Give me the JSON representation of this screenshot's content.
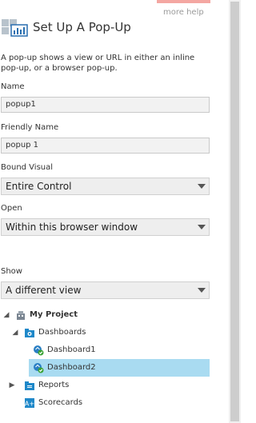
{
  "header": {
    "more_help": "more help",
    "title": "Set Up A Pop-Up",
    "description": "A pop-up shows a view or URL in either an inline pop-up, or a browser pop-up."
  },
  "fields": {
    "name_label": "Name",
    "name_value": "popup1",
    "friendly_label": "Friendly Name",
    "friendly_value": "popup 1",
    "bound_label": "Bound Visual",
    "bound_value": "Entire Control",
    "open_label": "Open",
    "open_value": "Within this browser window",
    "show_label": "Show",
    "show_value": "A different view"
  },
  "tree": {
    "project": "My Project",
    "dashboards": "Dashboards",
    "dashboard1": "Dashboard1",
    "dashboard2": "Dashboard2",
    "reports": "Reports",
    "scorecards": "Scorecards"
  },
  "colors": {
    "selected_row": "#a9dbf1",
    "folder_icon": "#1e88c9",
    "top_accent": "#f4a7a2"
  },
  "icons": {
    "title": "popup-setup-icon",
    "project": "project-building-icon",
    "folder": "folder-icon",
    "dashboard": "dashboard-check-icon",
    "scorecard": "scorecard-icon"
  }
}
